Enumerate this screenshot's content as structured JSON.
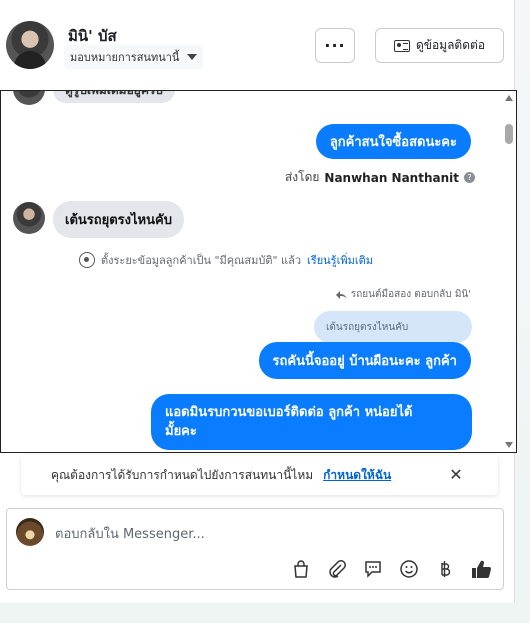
{
  "header": {
    "name": "มินิ' บัส",
    "assign_label": "มอบหมายการสนทนานี้",
    "more_label": "···",
    "contact_label": "ดูข้อมูลติดต่อ"
  },
  "messages": {
    "top_partial": "ดูรูปเพิ่มเติมอยู่ครับ",
    "out_1": "ลูกค้าสนใจซื้อสดนะคะ",
    "sent_by_prefix": "ส่งโดย",
    "sent_by_name": "Nanwhan Nanthanit",
    "in_1": "เต้นรถยุตรงไหนคับ",
    "notice_text": "ตั้งระยะข้อมูลลูกค้าเป็น \"มีคุณสมบัติ\" แล้ว",
    "notice_link": "เรียนรู้เพิ่มเติม",
    "reply_label": "รถยนต์มือสอง ตอบกลับ มินิ'",
    "quoted": "เต้นรถยุตรงไหนคับ",
    "out_2": "รถคันนี้จออยู่ บ้านผือนะคะ  ลูกค้า",
    "out_3_line1": "แอดมินรบกวนขอเบอร์ติดต่อ ลูกค้า   หน่อยได้",
    "out_3_line2": "มั้ยคะ"
  },
  "permission": {
    "text": "คุณต้องการได้รับการกำหนดไปยังการสนทนานี้ไหม",
    "link": "กำหนดให้ฉัน",
    "close": "✕"
  },
  "composer": {
    "placeholder": "ตอบกลับใน Messenger..."
  },
  "colors": {
    "accent": "#0a7cff",
    "incoming": "#e4e6eb",
    "link": "#0064d1"
  }
}
